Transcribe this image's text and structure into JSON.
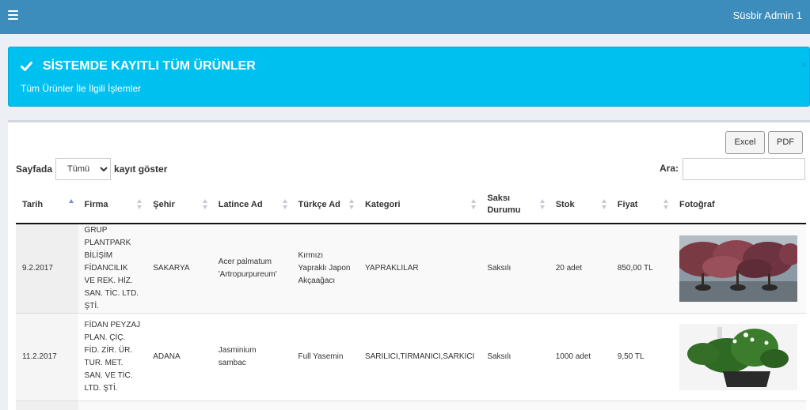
{
  "header": {
    "menu_icon": "hamburger-icon",
    "user": "Süsbir Admin 1"
  },
  "alert": {
    "icon": "check-icon",
    "title": "SİSTEMDE KAYITLI TÜM ÜRÜNLER",
    "subtitle": "Tüm Ürünler İle İlgili İşlemler",
    "close": "×"
  },
  "toolbar": {
    "excel": "Excel",
    "pdf": "PDF"
  },
  "length": {
    "prefix": "Sayfada",
    "selected": "Tümü",
    "suffix": "kayıt göster"
  },
  "search": {
    "label": "Ara:",
    "value": ""
  },
  "table": {
    "headers": [
      "Tarih",
      "Firma",
      "Şehir",
      "Latince Ad",
      "Türkçe Ad",
      "Kategori",
      "Saksı Durumu",
      "Stok",
      "Fiyat",
      "Fotoğraf"
    ],
    "sorted_column": "Tarih",
    "rows": [
      {
        "tarih": "9.2.2017",
        "firma": "GRUP PLANTPARK BİLİŞİM FİDANCILIK VE REK. HİZ. SAN. TİC. LTD. ŞTİ.",
        "sehir": "SAKARYA",
        "latince": "Acer palmatum 'Artropurpureum'",
        "turkce": "Kırmızı Yapraklı Japon Akçaağacı",
        "kategori": "YAPRAKLILAR",
        "saksi": "Saksılı",
        "stok": "20 adet",
        "fiyat": "850,00 TL",
        "photo": "red-maple-photo"
      },
      {
        "tarih": "11.2.2017",
        "firma": "FİDAN PEYZAJ PLAN. ÇİÇ. FİD. ZİR. ÜR. TUR. MET. SAN. VE TİC. LTD. ŞTİ.",
        "sehir": "ADANA",
        "latince": "Jasminium sambac",
        "turkce": "Full Yasemin",
        "kategori": "SARILICI,TIRMANICI,SARKICI",
        "saksi": "Saksılı",
        "stok": "1000 adet",
        "fiyat": "9,50 TL",
        "photo": "jasmine-plant-photo"
      }
    ]
  },
  "colors": {
    "topbar": "#3c8dbc",
    "alert": "#00c0ef",
    "background": "#ecf0f5"
  }
}
